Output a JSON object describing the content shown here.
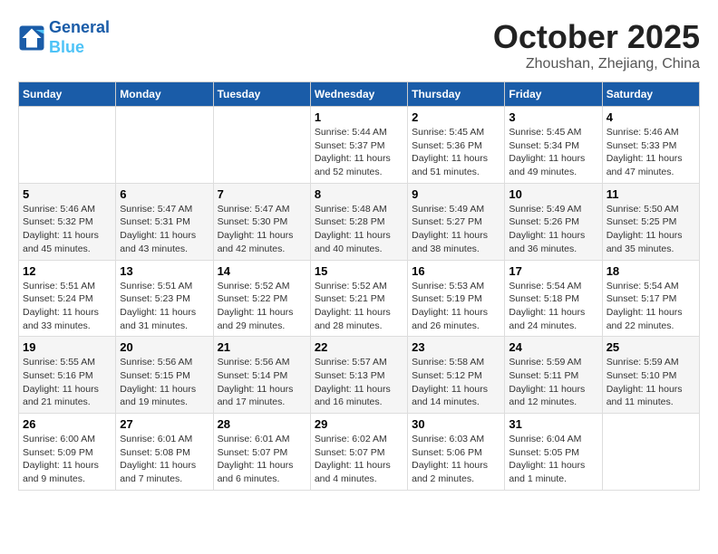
{
  "header": {
    "logo_line1": "General",
    "logo_line2": "Blue",
    "month_title": "October 2025",
    "location": "Zhoushan, Zhejiang, China"
  },
  "weekdays": [
    "Sunday",
    "Monday",
    "Tuesday",
    "Wednesday",
    "Thursday",
    "Friday",
    "Saturday"
  ],
  "weeks": [
    [
      {
        "day": "",
        "info": ""
      },
      {
        "day": "",
        "info": ""
      },
      {
        "day": "",
        "info": ""
      },
      {
        "day": "1",
        "info": "Sunrise: 5:44 AM\nSunset: 5:37 PM\nDaylight: 11 hours\nand 52 minutes."
      },
      {
        "day": "2",
        "info": "Sunrise: 5:45 AM\nSunset: 5:36 PM\nDaylight: 11 hours\nand 51 minutes."
      },
      {
        "day": "3",
        "info": "Sunrise: 5:45 AM\nSunset: 5:34 PM\nDaylight: 11 hours\nand 49 minutes."
      },
      {
        "day": "4",
        "info": "Sunrise: 5:46 AM\nSunset: 5:33 PM\nDaylight: 11 hours\nand 47 minutes."
      }
    ],
    [
      {
        "day": "5",
        "info": "Sunrise: 5:46 AM\nSunset: 5:32 PM\nDaylight: 11 hours\nand 45 minutes."
      },
      {
        "day": "6",
        "info": "Sunrise: 5:47 AM\nSunset: 5:31 PM\nDaylight: 11 hours\nand 43 minutes."
      },
      {
        "day": "7",
        "info": "Sunrise: 5:47 AM\nSunset: 5:30 PM\nDaylight: 11 hours\nand 42 minutes."
      },
      {
        "day": "8",
        "info": "Sunrise: 5:48 AM\nSunset: 5:28 PM\nDaylight: 11 hours\nand 40 minutes."
      },
      {
        "day": "9",
        "info": "Sunrise: 5:49 AM\nSunset: 5:27 PM\nDaylight: 11 hours\nand 38 minutes."
      },
      {
        "day": "10",
        "info": "Sunrise: 5:49 AM\nSunset: 5:26 PM\nDaylight: 11 hours\nand 36 minutes."
      },
      {
        "day": "11",
        "info": "Sunrise: 5:50 AM\nSunset: 5:25 PM\nDaylight: 11 hours\nand 35 minutes."
      }
    ],
    [
      {
        "day": "12",
        "info": "Sunrise: 5:51 AM\nSunset: 5:24 PM\nDaylight: 11 hours\nand 33 minutes."
      },
      {
        "day": "13",
        "info": "Sunrise: 5:51 AM\nSunset: 5:23 PM\nDaylight: 11 hours\nand 31 minutes."
      },
      {
        "day": "14",
        "info": "Sunrise: 5:52 AM\nSunset: 5:22 PM\nDaylight: 11 hours\nand 29 minutes."
      },
      {
        "day": "15",
        "info": "Sunrise: 5:52 AM\nSunset: 5:21 PM\nDaylight: 11 hours\nand 28 minutes."
      },
      {
        "day": "16",
        "info": "Sunrise: 5:53 AM\nSunset: 5:19 PM\nDaylight: 11 hours\nand 26 minutes."
      },
      {
        "day": "17",
        "info": "Sunrise: 5:54 AM\nSunset: 5:18 PM\nDaylight: 11 hours\nand 24 minutes."
      },
      {
        "day": "18",
        "info": "Sunrise: 5:54 AM\nSunset: 5:17 PM\nDaylight: 11 hours\nand 22 minutes."
      }
    ],
    [
      {
        "day": "19",
        "info": "Sunrise: 5:55 AM\nSunset: 5:16 PM\nDaylight: 11 hours\nand 21 minutes."
      },
      {
        "day": "20",
        "info": "Sunrise: 5:56 AM\nSunset: 5:15 PM\nDaylight: 11 hours\nand 19 minutes."
      },
      {
        "day": "21",
        "info": "Sunrise: 5:56 AM\nSunset: 5:14 PM\nDaylight: 11 hours\nand 17 minutes."
      },
      {
        "day": "22",
        "info": "Sunrise: 5:57 AM\nSunset: 5:13 PM\nDaylight: 11 hours\nand 16 minutes."
      },
      {
        "day": "23",
        "info": "Sunrise: 5:58 AM\nSunset: 5:12 PM\nDaylight: 11 hours\nand 14 minutes."
      },
      {
        "day": "24",
        "info": "Sunrise: 5:59 AM\nSunset: 5:11 PM\nDaylight: 11 hours\nand 12 minutes."
      },
      {
        "day": "25",
        "info": "Sunrise: 5:59 AM\nSunset: 5:10 PM\nDaylight: 11 hours\nand 11 minutes."
      }
    ],
    [
      {
        "day": "26",
        "info": "Sunrise: 6:00 AM\nSunset: 5:09 PM\nDaylight: 11 hours\nand 9 minutes."
      },
      {
        "day": "27",
        "info": "Sunrise: 6:01 AM\nSunset: 5:08 PM\nDaylight: 11 hours\nand 7 minutes."
      },
      {
        "day": "28",
        "info": "Sunrise: 6:01 AM\nSunset: 5:07 PM\nDaylight: 11 hours\nand 6 minutes."
      },
      {
        "day": "29",
        "info": "Sunrise: 6:02 AM\nSunset: 5:07 PM\nDaylight: 11 hours\nand 4 minutes."
      },
      {
        "day": "30",
        "info": "Sunrise: 6:03 AM\nSunset: 5:06 PM\nDaylight: 11 hours\nand 2 minutes."
      },
      {
        "day": "31",
        "info": "Sunrise: 6:04 AM\nSunset: 5:05 PM\nDaylight: 11 hours\nand 1 minute."
      },
      {
        "day": "",
        "info": ""
      }
    ]
  ]
}
